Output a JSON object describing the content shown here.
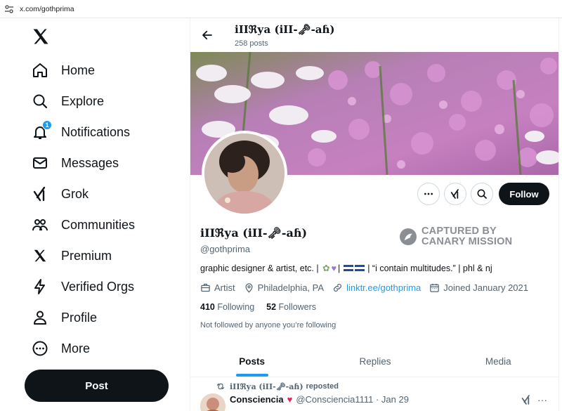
{
  "browser": {
    "url": "x.com/gothprima"
  },
  "sidebar": {
    "items": [
      {
        "label": "Home",
        "icon": "home-icon"
      },
      {
        "label": "Explore",
        "icon": "search-icon"
      },
      {
        "label": "Notifications",
        "icon": "bell-icon",
        "badge": "1"
      },
      {
        "label": "Messages",
        "icon": "envelope-icon"
      },
      {
        "label": "Grok",
        "icon": "grok-icon"
      },
      {
        "label": "Communities",
        "icon": "people-icon"
      },
      {
        "label": "Premium",
        "icon": "x-logo-icon"
      },
      {
        "label": "Verified Orgs",
        "icon": "lightning-icon"
      },
      {
        "label": "Profile",
        "icon": "person-icon"
      },
      {
        "label": "More",
        "icon": "more-circle-icon"
      }
    ],
    "post_label": "Post"
  },
  "header": {
    "name": "iIIℜуa (iII-🗝-aɦ)",
    "post_count": "258 posts"
  },
  "profile": {
    "name": "iIIℜуa (iII-🗝-aɦ)",
    "handle": "@gothprima",
    "stamp_line1": "CAPTURED BY",
    "stamp_line2": "CANARY MISSION",
    "bio_start": "graphic designer & artist, etc. |",
    "bio_end": "| “i contain multitudes.” | phl & nj",
    "category": "Artist",
    "location": "Philadelphia, PA",
    "link": "linktr.ee/gothprima",
    "joined": "Joined January 2021",
    "following_count": "410",
    "following_label": "Following",
    "followers_count": "52",
    "followers_label": "Followers",
    "not_followed": "Not followed by anyone you’re following",
    "follow_label": "Follow"
  },
  "tabs": [
    {
      "label": "Posts",
      "active": true
    },
    {
      "label": "Replies",
      "active": false
    },
    {
      "label": "Media",
      "active": false
    }
  ],
  "post": {
    "repost_name": "iIIℜуa (iII-🗝-aɦ)",
    "repost_label": "reposted",
    "author": "Consciencia",
    "handle_time": "@Consciencia1111 · Jan 29"
  },
  "colors": {
    "accent": "#1d9bf0",
    "dark": "#0f1419",
    "muted": "#536471"
  }
}
